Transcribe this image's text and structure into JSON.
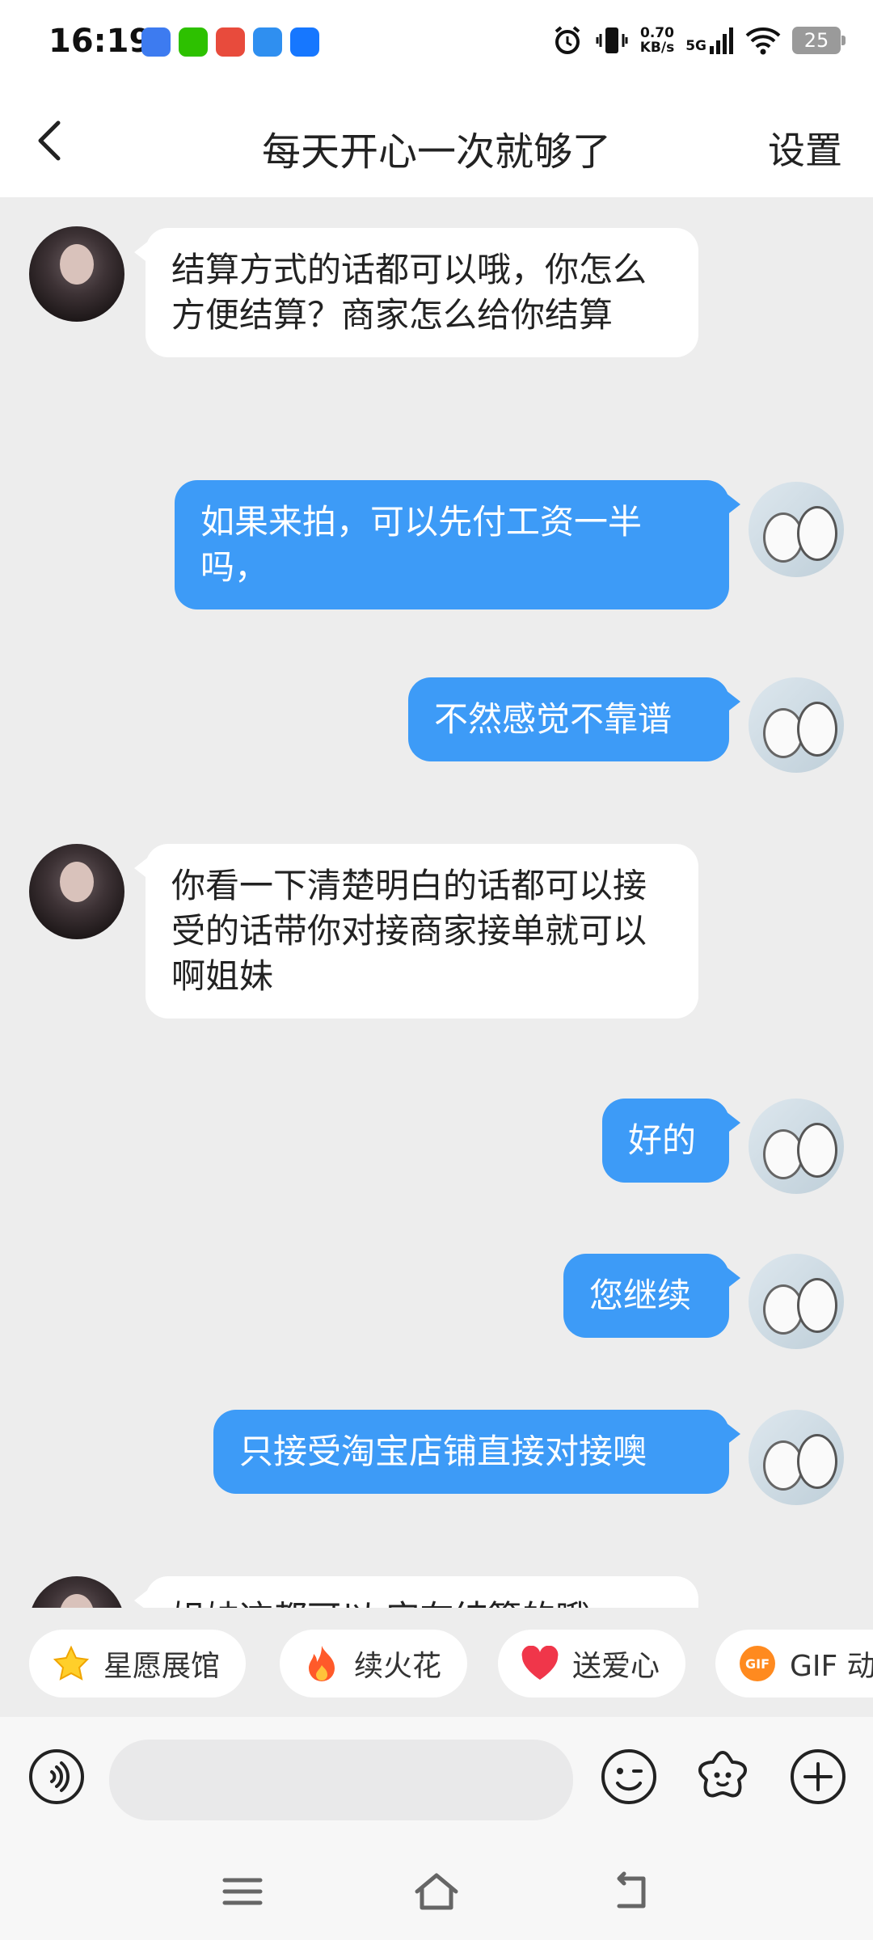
{
  "status_bar": {
    "time": "16:19",
    "net_speed_value": "0.70",
    "net_speed_unit": "KB/s",
    "network": "5G",
    "battery": "25"
  },
  "header": {
    "title": "每天开心一次就够了",
    "settings_label": "设置"
  },
  "messages": [
    {
      "side": "in",
      "text": "结算方式的话都可以哦，你怎么方便结算？商家怎么给你结算"
    },
    {
      "side": "out",
      "text": "如果来拍，可以先付工资一半吗，"
    },
    {
      "side": "out",
      "text": "不然感觉不靠谱"
    },
    {
      "side": "in",
      "text": "你看一下清楚明白的话都可以接受的话带你对接商家接单就可以啊姐妹"
    },
    {
      "side": "out",
      "text": "好的"
    },
    {
      "side": "out",
      "text": "您继续"
    },
    {
      "side": "out",
      "text": "只接受淘宝店铺直接对接噢"
    },
    {
      "side": "in",
      "text": "姐妹这都可以 实在结算的哦"
    }
  ],
  "quick_actions": [
    {
      "icon": "star-icon",
      "label": "星愿展馆"
    },
    {
      "icon": "flame-icon",
      "label": "续火花"
    },
    {
      "icon": "heart-icon",
      "label": "送爱心"
    },
    {
      "icon": "gif-icon",
      "label": "GIF 动"
    }
  ],
  "input": {
    "placeholder": ""
  },
  "colors": {
    "accent": "#3d9bf7",
    "background": "#ededed"
  }
}
